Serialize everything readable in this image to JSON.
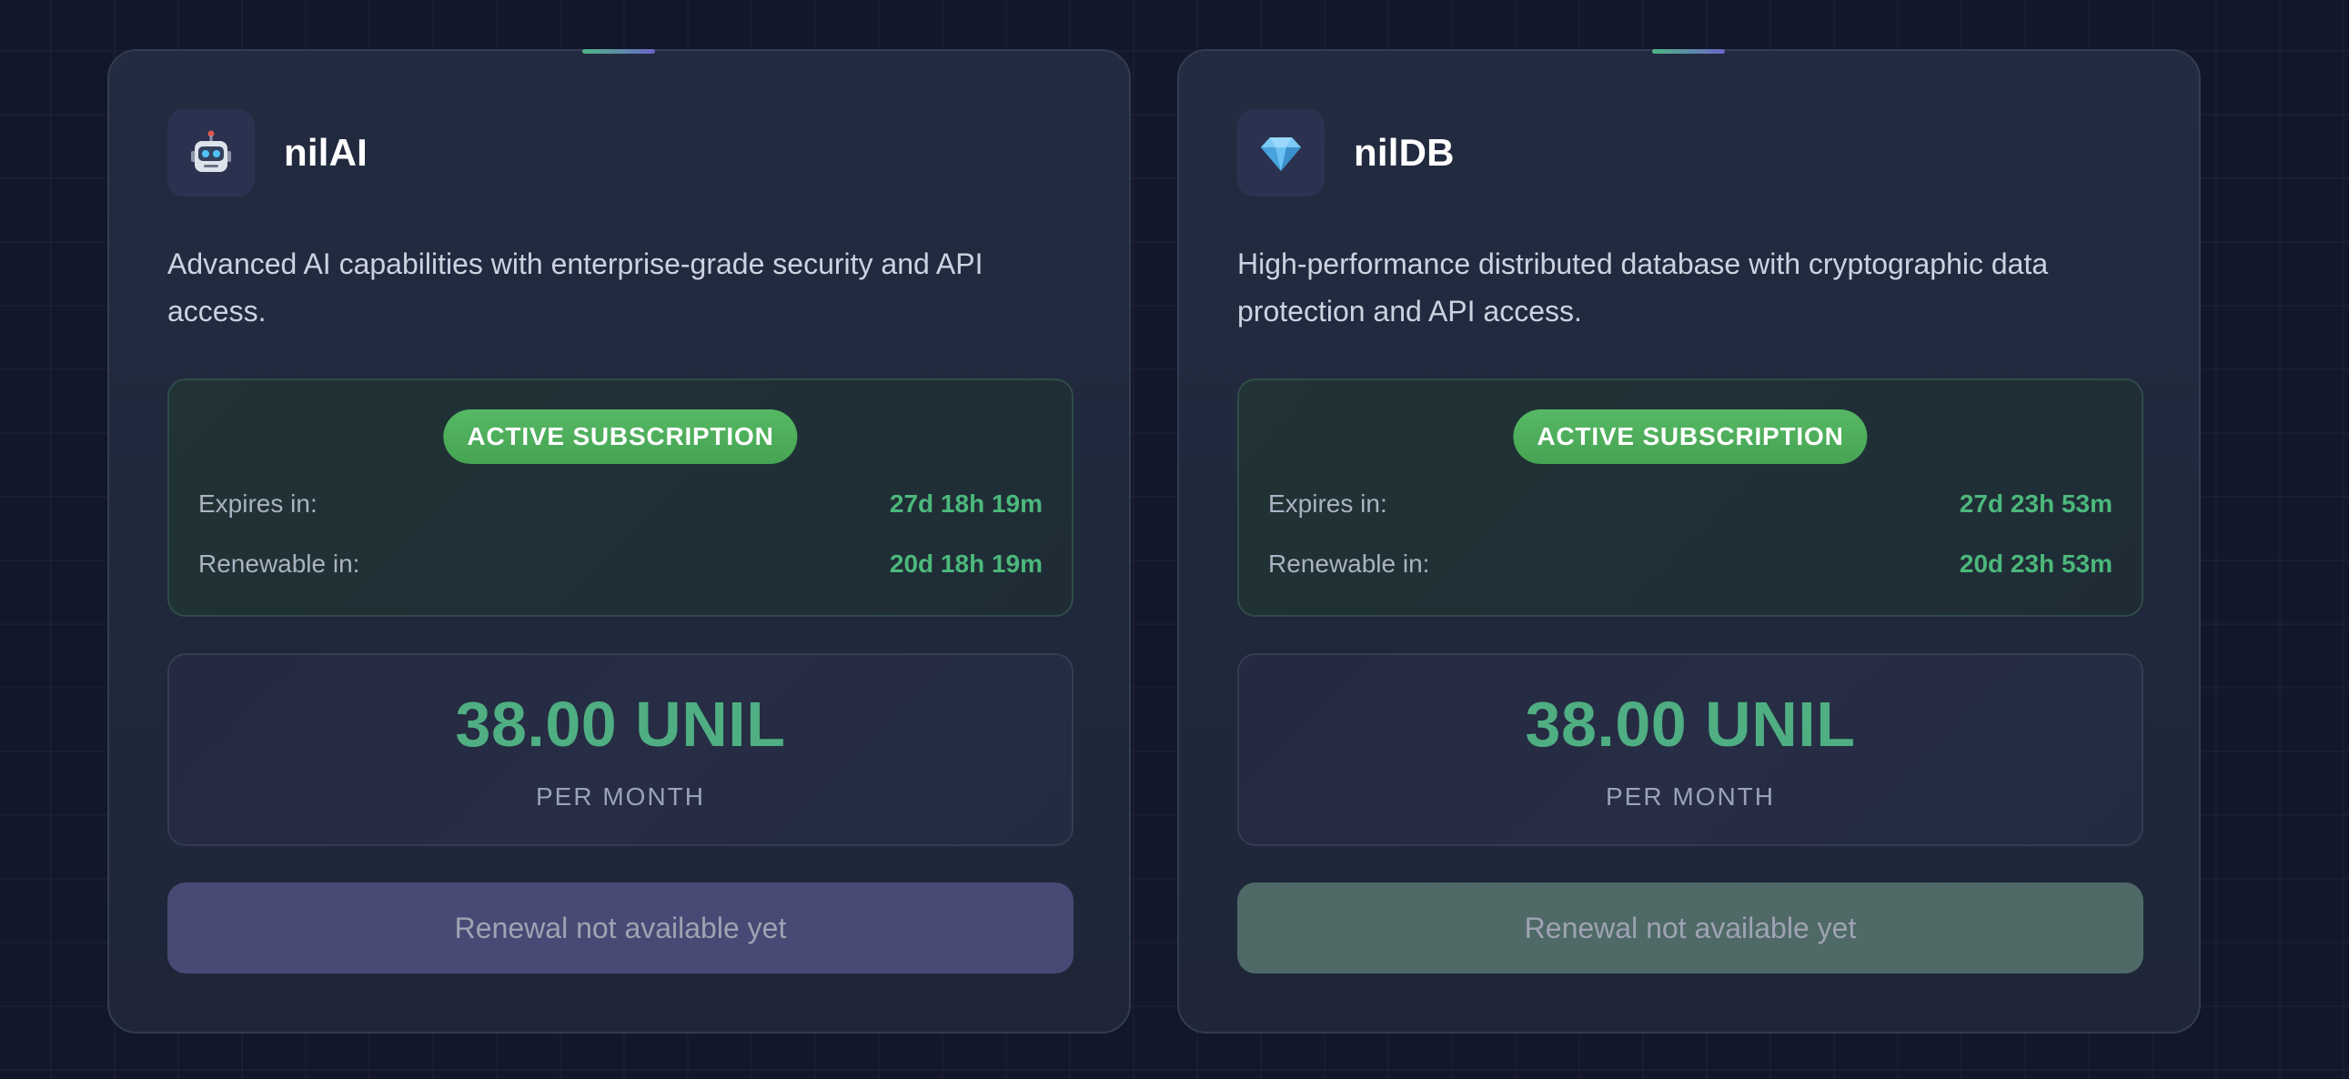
{
  "services": [
    {
      "icon": "robot-icon",
      "name": "nilAI",
      "description": "Advanced AI capabilities with enterprise-grade security and API access.",
      "status_badge": "ACTIVE SUBSCRIPTION",
      "expires_label": "Expires in:",
      "expires_value": "27d 18h 19m",
      "renewable_label": "Renewable in:",
      "renewable_value": "20d 18h 19m",
      "price": "38.00 UNIL",
      "period": "PER MONTH",
      "button_label": "Renewal not available yet",
      "button_color": "#474a74"
    },
    {
      "icon": "gem-icon",
      "name": "nilDB",
      "description": "High-performance distributed database with cryptographic data protection and API access.",
      "status_badge": "ACTIVE SUBSCRIPTION",
      "expires_label": "Expires in:",
      "expires_value": "27d 23h 53m",
      "renewable_label": "Renewable in:",
      "renewable_value": "20d 23h 53m",
      "price": "38.00 UNIL",
      "period": "PER MONTH",
      "button_label": "Renewal not available yet",
      "button_color": "#4f6967"
    }
  ],
  "colors": {
    "background": "#121729",
    "card": "#222b40",
    "accent_green": "#4cb87c",
    "badge_green": "#4fb360",
    "price_green": "#4fae82"
  }
}
